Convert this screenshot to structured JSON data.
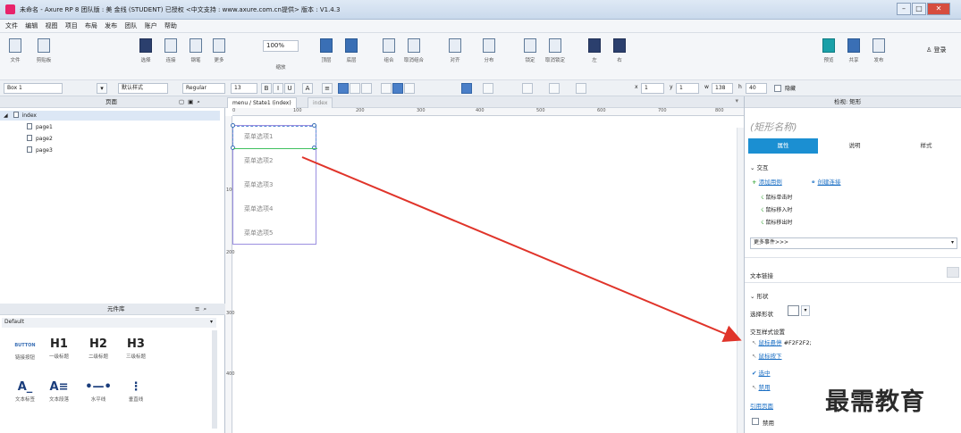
{
  "window": {
    "title": "未命名 - Axure RP 8 团队版 : 美 金线 (STUDENT) 已授权    <中文支持 : www.axure.com.cn提供> 版本 : V1.4.3"
  },
  "menu": [
    "文件",
    "编辑",
    "视图",
    "项目",
    "布局",
    "发布",
    "团队",
    "账户",
    "帮助"
  ],
  "toolbar": {
    "tools": [
      {
        "label": "文件"
      },
      {
        "label": "剪贴板"
      },
      {
        "label": "选择"
      },
      {
        "label": "连接"
      },
      {
        "label": "钢笔"
      },
      {
        "label": "更多"
      },
      {
        "label": "缩放"
      },
      {
        "label": "顶层"
      },
      {
        "label": "底层"
      },
      {
        "label": "组合"
      },
      {
        "label": "取消组合"
      },
      {
        "label": "对齐"
      },
      {
        "label": "分布"
      },
      {
        "label": "锁定"
      },
      {
        "label": "取消锁定"
      },
      {
        "label": "左"
      },
      {
        "label": "右"
      },
      {
        "label": "预览"
      },
      {
        "label": "共享"
      },
      {
        "label": "发布"
      }
    ],
    "zoom": "100%",
    "login": "登录"
  },
  "format": {
    "widget_name": "Box 1",
    "style": "默认样式",
    "font_weight": "Regular",
    "font_size": "13",
    "x_label": "x",
    "x_value": "1",
    "y_label": "y",
    "y_value": "1",
    "w_label": "w",
    "w_value": "138",
    "h_label": "h",
    "h_value": "40",
    "hidden_label": "隐藏"
  },
  "pages": {
    "title": "页面",
    "items": [
      "index",
      "page1",
      "page2",
      "page3"
    ]
  },
  "library": {
    "title": "元件库",
    "selected": "Default",
    "items": [
      {
        "glyph": "BUTTON",
        "caption": "链接按钮"
      },
      {
        "glyph": "H1",
        "caption": "一级标题"
      },
      {
        "glyph": "H2",
        "caption": "二级标题"
      },
      {
        "glyph": "H3",
        "caption": "三级标题"
      },
      {
        "glyph": "A_",
        "caption": "文本标签"
      },
      {
        "glyph": "A≡",
        "caption": "文本段落"
      },
      {
        "glyph": "•—•",
        "caption": "水平线"
      },
      {
        "glyph": "⋮",
        "caption": "垂直线"
      }
    ]
  },
  "canvas": {
    "tabs": [
      "menu / State1 (index)",
      "index"
    ],
    "ruler_h": [
      "0",
      "100",
      "200",
      "300",
      "400",
      "500",
      "600",
      "700",
      "800"
    ],
    "ruler_v": [
      "100",
      "200",
      "300",
      "400"
    ],
    "menu_items": [
      "菜单选项1",
      "菜单选项2",
      "菜单选项3",
      "菜单选项4",
      "菜单选项5"
    ]
  },
  "inspector": {
    "header": "检视: 矩形",
    "name_placeholder": "(矩形名称)",
    "tabs": [
      "属性",
      "说明",
      "样式"
    ],
    "section_interaction": "交互",
    "add_case": "添加用例",
    "create_link": "创建连接",
    "events": [
      "鼠标单击时",
      "鼠标移入时",
      "鼠标移出时"
    ],
    "more_events": "更多事件>>>",
    "text_link": "文本链接",
    "section_shape": "形状",
    "select_shape": "选择形状",
    "interaction_styles": "交互样式设置",
    "style_items": [
      {
        "label": "鼠标悬停",
        "value": "#F2F2F2;"
      },
      {
        "label": "鼠标按下",
        "value": ""
      },
      {
        "label": "选中",
        "value": ""
      },
      {
        "label": "禁用",
        "value": ""
      }
    ],
    "ref_page": "引用页面",
    "disabled": "禁用"
  },
  "watermark": "最需教育",
  "colors": {
    "accent": "#1b8fd2",
    "arrow": "#e0342a",
    "selection": "#9b8fe0"
  }
}
